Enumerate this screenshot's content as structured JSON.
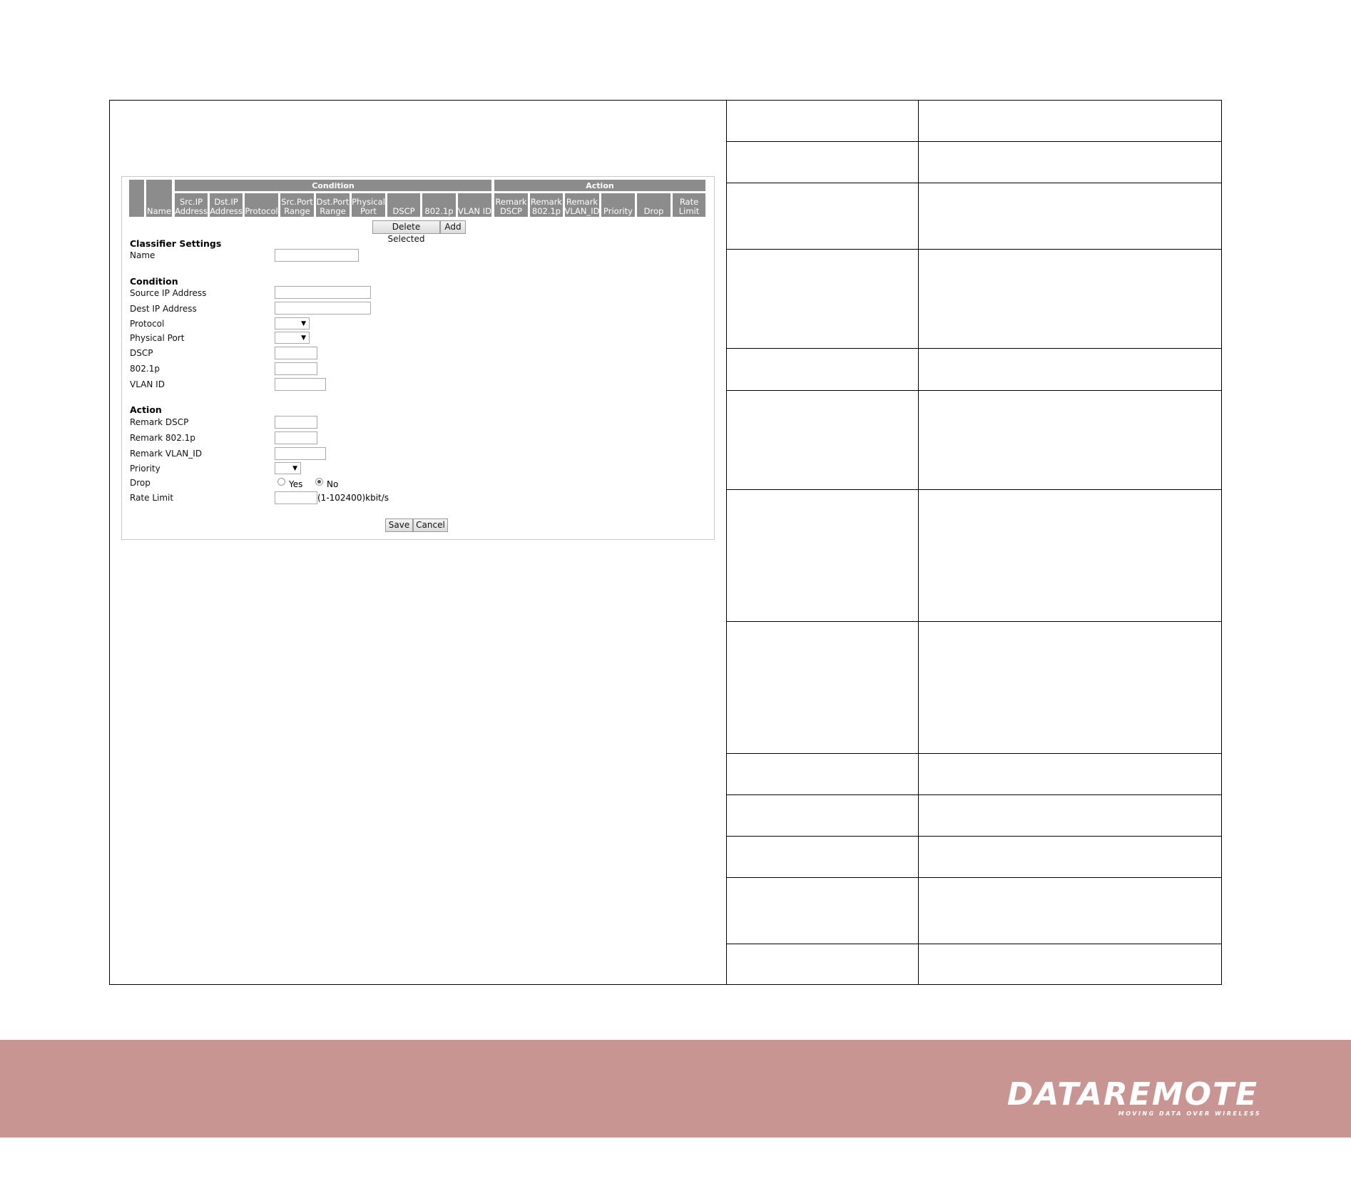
{
  "rule_table": {
    "group_headers": [
      "Condition",
      "Action"
    ],
    "columns": [
      {
        "id": "name",
        "label": "Name"
      },
      {
        "id": "src-ip",
        "label": "Src.IP Address"
      },
      {
        "id": "dst-ip",
        "label": "Dst.IP Address"
      },
      {
        "id": "protocol",
        "label": "Protocol"
      },
      {
        "id": "src-port",
        "label": "Src.Port Range"
      },
      {
        "id": "dst-port",
        "label": "Dst.Port Range"
      },
      {
        "id": "physical-port",
        "label": "Physical Port"
      },
      {
        "id": "dscp",
        "label": "DSCP"
      },
      {
        "id": "8021p",
        "label": "802.1p"
      },
      {
        "id": "vlan-id",
        "label": "VLAN ID"
      },
      {
        "id": "remark-dscp",
        "label": "Remark DSCP"
      },
      {
        "id": "remark-8021p",
        "label": "Remark 802.1p"
      },
      {
        "id": "remark-vlan",
        "label": "Remark VLAN_ID"
      },
      {
        "id": "priority",
        "label": "Priority"
      },
      {
        "id": "drop",
        "label": "Drop"
      },
      {
        "id": "rate-limit",
        "label": "Rate Limit"
      }
    ]
  },
  "table_buttons": {
    "delete": "Delete Selected",
    "add": "Add"
  },
  "classifier": {
    "title": "Classifier Settings",
    "name_label": "Name",
    "name_value": ""
  },
  "condition": {
    "title": "Condition",
    "source_ip_label": "Source IP Address",
    "source_ip_value": "",
    "dest_ip_label": "Dest IP Address",
    "dest_ip_value": "",
    "protocol_label": "Protocol",
    "protocol_value": "",
    "physical_port_label": "Physical Port",
    "physical_port_value": "",
    "dscp_label": "DSCP",
    "dscp_value": "",
    "p8021_label": "802.1p",
    "p8021_value": "",
    "vlan_label": "VLAN ID",
    "vlan_value": ""
  },
  "action": {
    "title": "Action",
    "remark_dscp_label": "Remark DSCP",
    "remark_dscp_value": "",
    "remark_8021p_label": "Remark 802.1p",
    "remark_8021p_value": "",
    "remark_vlan_label": "Remark VLAN_ID",
    "remark_vlan_value": "",
    "priority_label": "Priority",
    "priority_value": "",
    "drop_label": "Drop",
    "drop_yes": "Yes",
    "drop_no": "No",
    "drop_selected": "No",
    "rate_limit_label": "Rate Limit",
    "rate_limit_value": "",
    "rate_limit_hint": "(1-102400)kbit/s"
  },
  "form_buttons": {
    "save": "Save",
    "cancel": "Cancel"
  },
  "footer": {
    "logo_text": "DATAREMOTE",
    "tagline": "MOVING DATA OVER WIRELESS",
    "band_color": "#c99593"
  }
}
